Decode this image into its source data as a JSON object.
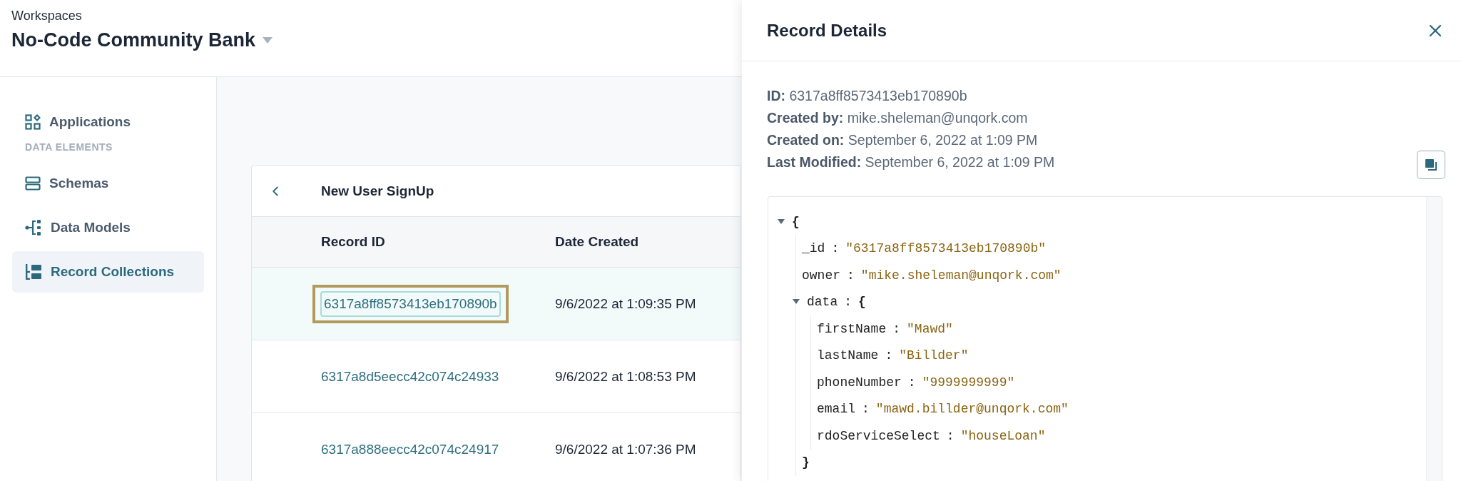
{
  "header": {
    "label": "Workspaces",
    "workspace": "No-Code Community Bank"
  },
  "sidebar": {
    "items": [
      {
        "kind": "item",
        "label": "Applications",
        "selected": false
      },
      {
        "kind": "section",
        "label": "DATA ELEMENTS"
      },
      {
        "kind": "item",
        "label": "Schemas",
        "selected": false
      },
      {
        "kind": "item",
        "label": "Data Models",
        "selected": false
      },
      {
        "kind": "item",
        "label": "Record Collections",
        "selected": true
      }
    ]
  },
  "table": {
    "title": "New User SignUp",
    "columns": [
      "Record ID",
      "Date Created"
    ],
    "rows": [
      {
        "id": "6317a8ff8573413eb170890b",
        "date": "9/6/2022 at 1:09:35 PM",
        "selected": true
      },
      {
        "id": "6317a8d5eecc42c074c24933",
        "date": "9/6/2022 at 1:08:53 PM",
        "selected": false
      },
      {
        "id": "6317a888eecc42c074c24917",
        "date": "9/6/2022 at 1:07:36 PM",
        "selected": false
      }
    ]
  },
  "panel": {
    "title": "Record Details",
    "info": [
      "**ID:** 6317a8ff8573413eb170890b",
      "**Created by:** mike.sheleman@unqork.com",
      "**Created on:** September 6, 2022 at 1:09 PM",
      "**Last Modified:** September 6, 2022 at 1:09 PM"
    ],
    "json": [
      {
        "open": "{",
        "expanded": true,
        "children": [
          {
            "key": "_id",
            "sep": ":",
            "value": "\"6317a8ff8573413eb170890b\""
          },
          {
            "key": "owner",
            "sep": ":",
            "value": "\"mike.sheleman@unqork.com\""
          },
          {
            "key": "data",
            "sep": ":",
            "open": "{",
            "expanded": true,
            "close": "}",
            "children": [
              {
                "key": "firstName",
                "sep": ":",
                "value": "\"Mawd\""
              },
              {
                "key": "lastName",
                "sep": ":",
                "value": "\"Billder\""
              },
              {
                "key": "phoneNumber",
                "sep": ":",
                "value": "\"9999999999\""
              },
              {
                "key": "email",
                "sep": ":",
                "value": "\"mawd.billder@unqork.com\""
              },
              {
                "key": "rdoServiceSelect",
                "sep": ":",
                "value": "\"houseLoan\""
              }
            ]
          }
        ]
      }
    ]
  }
}
